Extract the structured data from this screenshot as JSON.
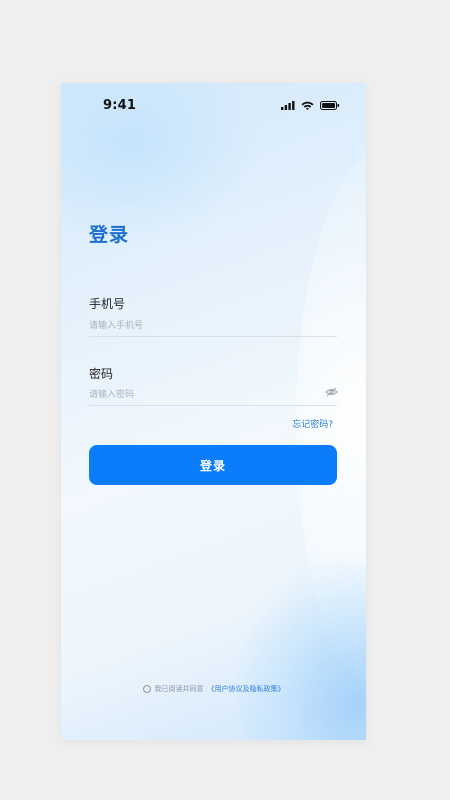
{
  "status_bar": {
    "time": "9:41",
    "icons": [
      "signal-icon",
      "wifi-icon",
      "battery-icon"
    ]
  },
  "login": {
    "title": "登录",
    "phone_label": "手机号",
    "phone_placeholder": "请输入手机号",
    "password_label": "密码",
    "password_placeholder": "请输入密码",
    "forgot_link": "忘记密码?",
    "button_label": "登录"
  },
  "agreement": {
    "text": "我已阅读并同意",
    "link": "《用户协议及隐私政策》"
  },
  "colors": {
    "accent": "#0b7dfa",
    "title": "#1b6fd3",
    "link": "#2a7bd6"
  }
}
